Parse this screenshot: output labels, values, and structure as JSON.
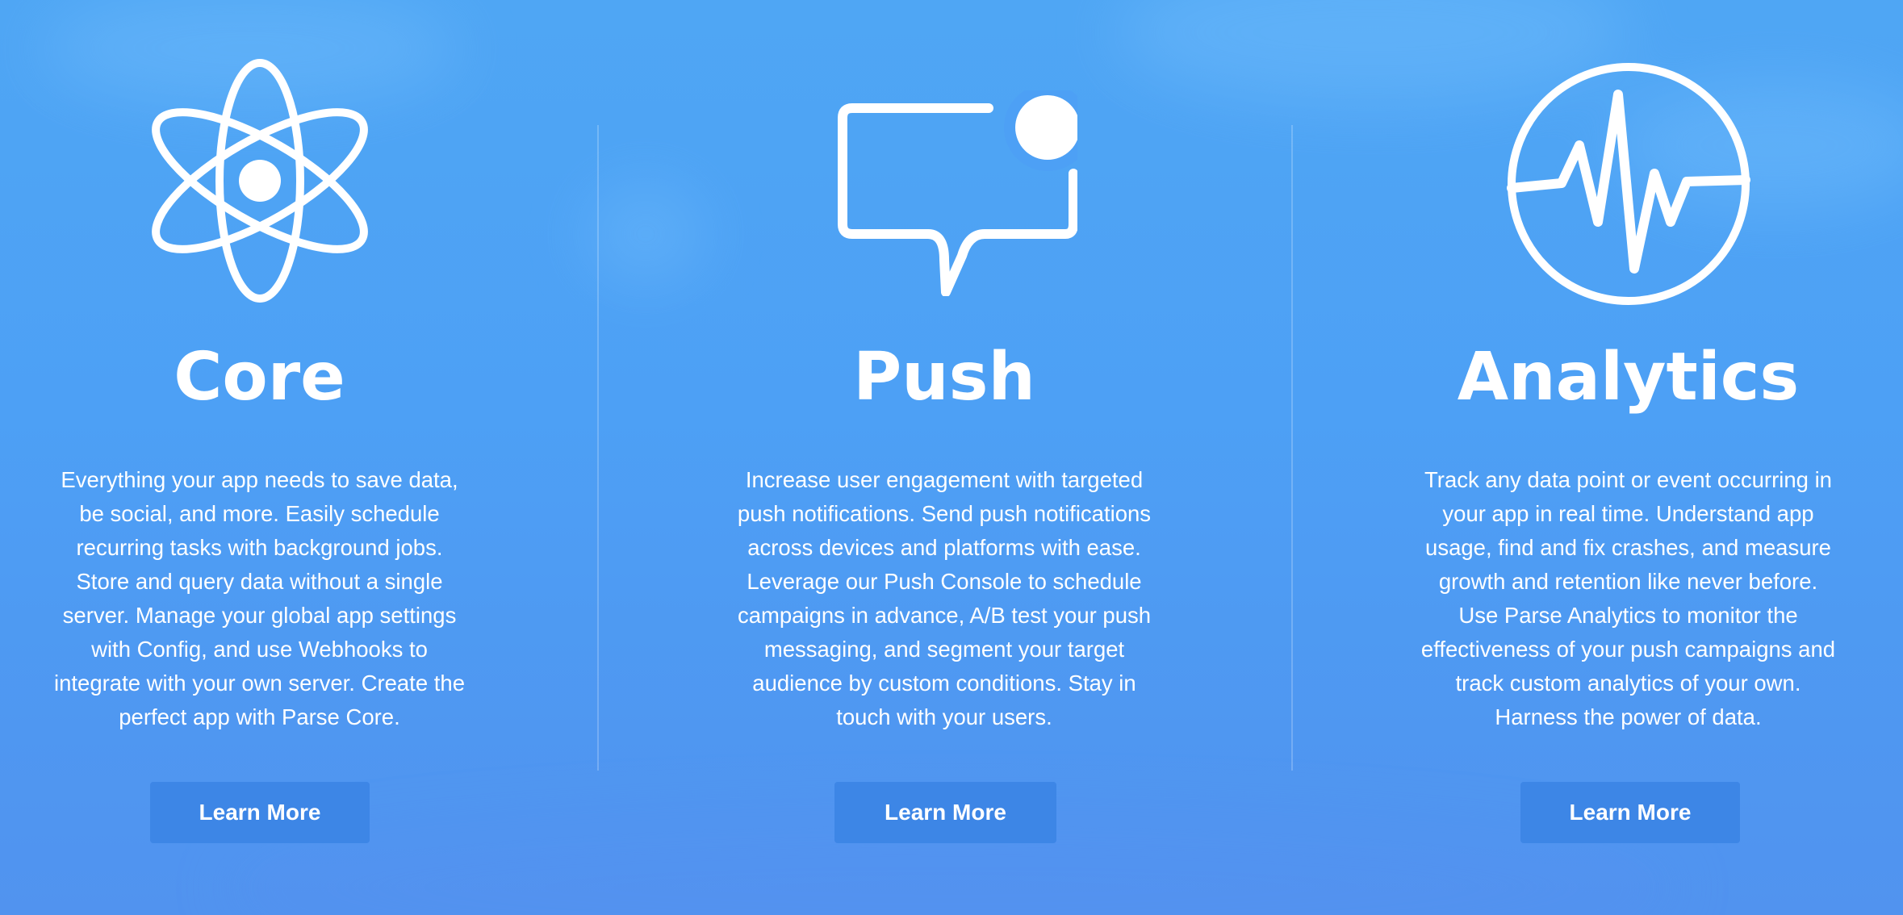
{
  "colors": {
    "background_top": "#4fa6f4",
    "background_bottom": "#5193ef",
    "button": "#3d86e6",
    "text": "#ffffff"
  },
  "features": [
    {
      "icon": "atom-icon",
      "title": "Core",
      "description": "Everything your app needs to save data, be social, and more. Easily schedule recurring tasks with background jobs. Store and query data without a single server. Manage your global app settings with Config, and use Webhooks to integrate with your own server. Create the perfect app with Parse Core.",
      "button_label": "Learn More"
    },
    {
      "icon": "chat-notification-icon",
      "title": "Push",
      "description": "Increase user engagement with targeted push notifications. Send push notifications across devices and platforms with ease. Leverage our Push Console to schedule campaigns in advance, A/B test your push messaging, and segment your target audience by custom conditions. Stay in touch with your users.",
      "button_label": "Learn More"
    },
    {
      "icon": "pulse-circle-icon",
      "title": "Analytics",
      "description": "Track any data point or event occurring in your app in real time. Understand app usage, find and fix crashes, and measure growth and retention like never before. Use Parse Analytics to monitor the effectiveness of your push campaigns and track custom analytics of your own. Harness the power of data.",
      "button_label": "Learn More"
    }
  ]
}
